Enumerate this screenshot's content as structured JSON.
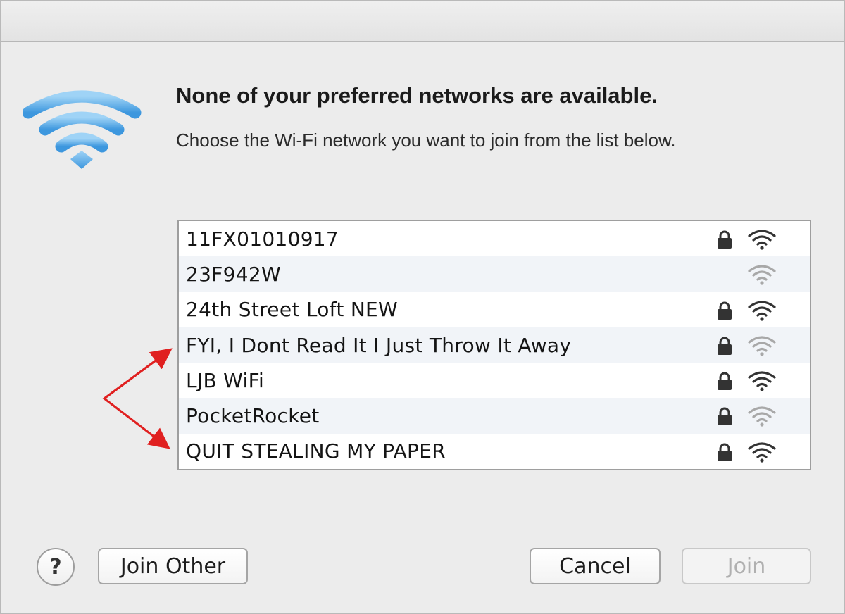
{
  "dialog": {
    "heading": "None of your preferred networks are available.",
    "subheading": "Choose the Wi-Fi network you want to join from the list below."
  },
  "networks": [
    {
      "name": "11FX01010917",
      "secured": true,
      "signal": "strong"
    },
    {
      "name": "23F942W",
      "secured": false,
      "signal": "weak"
    },
    {
      "name": "24th Street Loft NEW",
      "secured": true,
      "signal": "strong"
    },
    {
      "name": "FYI, I Dont Read It I Just Throw It Away",
      "secured": true,
      "signal": "weak"
    },
    {
      "name": "LJB WiFi",
      "secured": true,
      "signal": "strong"
    },
    {
      "name": "PocketRocket",
      "secured": true,
      "signal": "weak"
    },
    {
      "name": "QUIT STEALING MY PAPER",
      "secured": true,
      "signal": "strong"
    }
  ],
  "buttons": {
    "help": "?",
    "join_other": "Join Other",
    "cancel": "Cancel",
    "join": "Join",
    "join_enabled": false
  },
  "icons": {
    "logo": "wifi-logo-icon",
    "lock": "lock-icon",
    "signal": "wifi-signal-icon"
  },
  "colors": {
    "wifi_blue": "#4aa6e8",
    "annotation_red": "#e02020",
    "disabled_text": "#b0b0b0"
  }
}
